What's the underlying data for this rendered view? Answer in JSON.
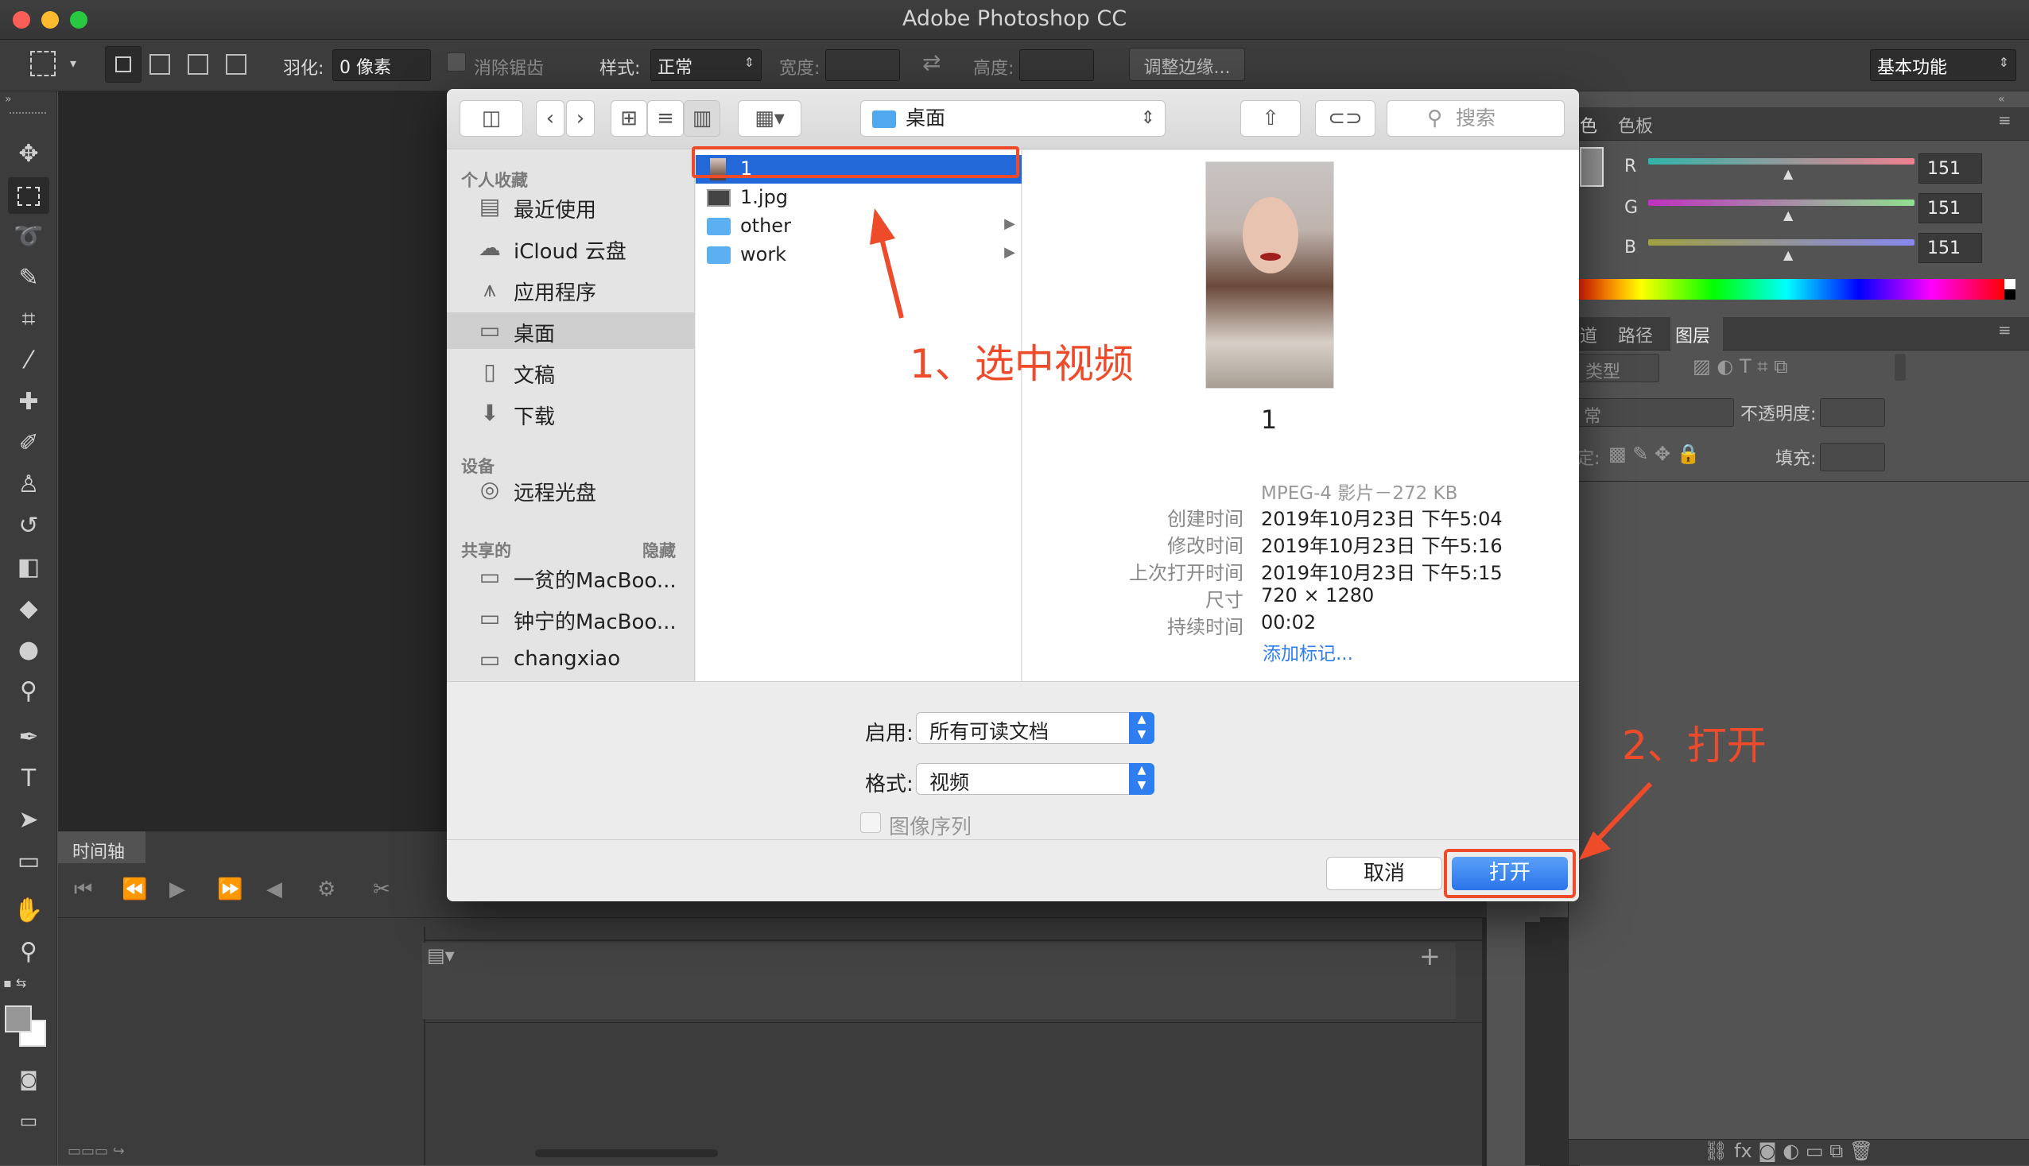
{
  "app": {
    "title": "Adobe Photoshop CC"
  },
  "options_bar": {
    "feather_label": "羽化:",
    "feather_value": "0 像素",
    "antialias_label": "消除锯齿",
    "style_label": "样式:",
    "style_value": "正常",
    "width_label": "宽度:",
    "height_label": "高度:",
    "refine_edge_button": "调整边缘...",
    "workspace_value": "基本功能"
  },
  "timeline": {
    "tab_label": "时间轴"
  },
  "right_panels": {
    "color_tabs": [
      "色",
      "色板"
    ],
    "channels": [
      {
        "label": "R",
        "value": "151"
      },
      {
        "label": "G",
        "value": "151"
      },
      {
        "label": "B",
        "value": "151"
      }
    ],
    "layer_tabs": [
      "道",
      "路径",
      "图层"
    ],
    "kind_label": "类型",
    "blend_mode": "常",
    "opacity_label": "不透明度:",
    "lock_label": "定:",
    "fill_label": "填充:"
  },
  "dialog": {
    "location": "桌面",
    "search_placeholder": "搜索",
    "sidebar": {
      "favorites_header": "个人收藏",
      "favorites": [
        "最近使用",
        "iCloud 云盘",
        "应用程序",
        "桌面",
        "文稿",
        "下载"
      ],
      "devices_header": "设备",
      "devices": [
        "远程光盘"
      ],
      "shared_header": "共享的",
      "shared_hide": "隐藏",
      "shared": [
        "一贫的MacBoo...",
        "钟宁的MacBoo...",
        "changxiao"
      ]
    },
    "files": [
      {
        "name": "1",
        "type": "video"
      },
      {
        "name": "1.jpg",
        "type": "image"
      },
      {
        "name": "other",
        "type": "folder"
      },
      {
        "name": "work",
        "type": "folder"
      }
    ],
    "preview": {
      "name": "1",
      "kind": "MPEG-4 影片－272 KB",
      "rows": [
        {
          "key": "创建时间",
          "value": "2019年10月23日 下午5:04"
        },
        {
          "key": "修改时间",
          "value": "2019年10月23日 下午5:16"
        },
        {
          "key": "上次打开时间",
          "value": "2019年10月23日 下午5:15"
        },
        {
          "key": "尺寸",
          "value": "720 × 1280"
        },
        {
          "key": "持续时间",
          "value": "00:02"
        }
      ],
      "add_tags": "添加标记..."
    },
    "enable_label": "启用:",
    "enable_value": "所有可读文档",
    "format_label": "格式:",
    "format_value": "视频",
    "image_sequence": "图像序列",
    "cancel": "取消",
    "open": "打开"
  },
  "annotations": {
    "step1": "1、选中视频",
    "step2": "2、打开",
    "color": "#ee4b2b"
  }
}
